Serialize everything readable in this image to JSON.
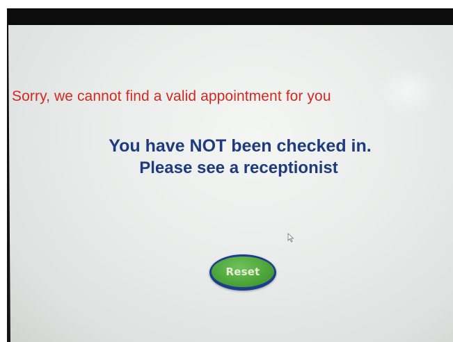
{
  "screen": {
    "error_message": "Sorry, we cannot find a valid appointment for you",
    "status_line_1": "You have NOT been checked in.",
    "status_line_2": "Please see a receptionist",
    "reset_label": "Reset"
  },
  "colors": {
    "error_text": "#d3281f",
    "status_text": "#1f3a7d",
    "button_fill": "#4ea63b",
    "button_border": "#1c3f8c",
    "screen_background": "#e9ecea"
  },
  "icons": {
    "cursor": "mouse-pointer-icon"
  }
}
